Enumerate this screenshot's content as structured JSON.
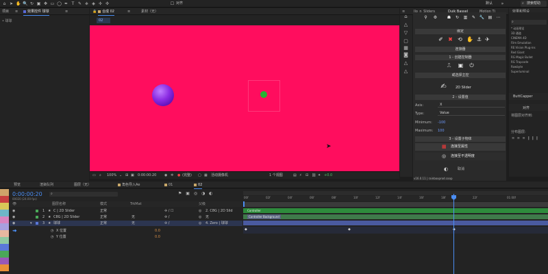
{
  "toolbar": {
    "align_label": "对齐",
    "workspace": "默认",
    "search_placeholder": "搜索帮助"
  },
  "left_panel": {
    "tab_project": "项目",
    "tab_effects": "效果控件 球球",
    "breadcrumb": "• 球球"
  },
  "viewer": {
    "tab_comp": "合成 02",
    "tab_footage": "素材（无）",
    "comp_chip": "02",
    "zoom": "100%",
    "timecode": "0:00:00:20",
    "quality": "(完整)",
    "camera": "活动摄像机",
    "views": "1 个视图",
    "exposure": "+0.0"
  },
  "duik": {
    "tab_sliders": "Ilo_n_Sliders",
    "tab_duik": "Duik Bassel",
    "tab_motion": "Motion Ti",
    "sec_bind": "绑定",
    "sec_connector": "连接器",
    "sec_create": "1 - 创建控制器",
    "sec_pick": "或选择主控",
    "slider_2d": "2D Slider",
    "sec_set": "2 - 设置值",
    "axis_label": "Axis:",
    "axis_value": "X",
    "type_label": "Type:",
    "type_value": "Value",
    "min_label": "Minimum:",
    "min_value": "-100",
    "max_label": "Maximum:",
    "max_value": "100",
    "sec_child": "3 - 设置子物体",
    "link_prop": "连接至属性",
    "link_opacity": "连接至不透明度",
    "version": "v16.0.11 | rainboxprod.coop",
    "cancel": "取消"
  },
  "fx": {
    "tab": "效果和预设",
    "items": [
      "* 动画预设",
      "3D 通道",
      "CINEMA 4D",
      "Film Emulation",
      "RE:Vision Plug-ins",
      "Red Giant",
      "RG Magic Bullet",
      "RG Trapcode",
      "Rowbyte",
      "Superluminal"
    ],
    "buttcapper": "ButtCapper",
    "align_tab": "对齐",
    "align_to": "将图层对齐到:",
    "distribute": "分布图层:"
  },
  "timeline": {
    "tabs": [
      "预览",
      "渲染队列",
      "图层（无）",
      "角色导入Ae",
      "01",
      "02"
    ],
    "timecode": "0:00:00:20",
    "fps": "00020 (24.00 fps)",
    "col_name": "图层名称",
    "col_mode": "模式",
    "col_trkmat": "TrkMat",
    "col_parent": "父级",
    "layers": [
      {
        "num": "1",
        "name": "C | 2D Slider",
        "mode": "正常",
        "trk": "",
        "parent": "2. C8G | 2D Slid"
      },
      {
        "num": "2",
        "name": "C8G | 2D Slider",
        "mode": "正常",
        "trk": "无",
        "parent": "无"
      },
      {
        "num": "3",
        "name": "球球",
        "mode": "正常",
        "trk": "无",
        "parent": "4. Zero | 球球"
      }
    ],
    "prop_x": "X 位置",
    "prop_y": "Y 位置",
    "prop_val": "0.0",
    "bar1_label": "Controller",
    "bar2_label": "Controller Background",
    "ruler": [
      "00f",
      "02f",
      "04f",
      "06f",
      "08f",
      "10f",
      "12f",
      "14f",
      "16f",
      "18f",
      "20f",
      "22f",
      "01:00f"
    ]
  },
  "colors": {
    "viewer_bg": "#ff0d5e",
    "sphere": "#8a2be2",
    "dot": "#23b432",
    "accent": "#4b8ef4",
    "bar_green": "#2e8b3c",
    "bar_blue": "#4a5aa0"
  }
}
